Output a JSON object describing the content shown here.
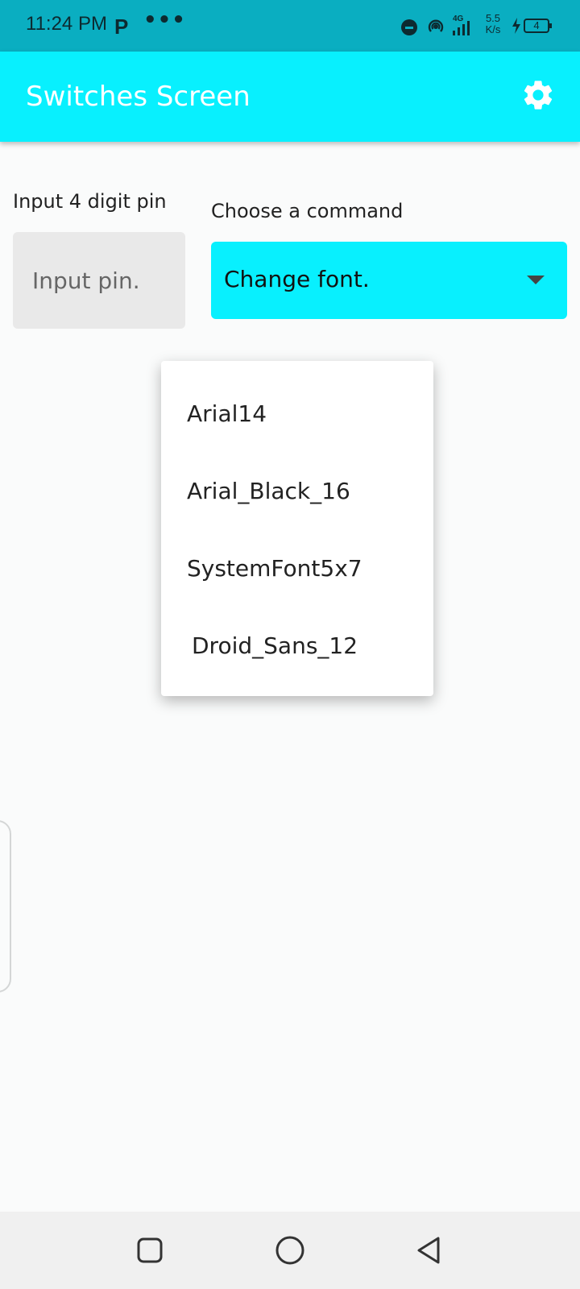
{
  "status_bar": {
    "time": "11:24 PM",
    "p_badge": "P",
    "dots": "•••",
    "speed_value": "5.5",
    "speed_unit": "K/s",
    "network": "4G",
    "battery": "4"
  },
  "app_bar": {
    "title": "Switches Screen",
    "settings_icon": "gear-icon"
  },
  "pin": {
    "label": "Input 4 digit pin",
    "placeholder": "Input pin.",
    "value": ""
  },
  "command": {
    "label": "Choose a command",
    "selected": "Change font."
  },
  "dropdown": {
    "options": [
      "Arial14",
      "Arial_Black_16",
      "SystemFont5x7",
      "Droid_Sans_12"
    ]
  },
  "colors": {
    "status_bar": "#0aaec1",
    "app_bar": "#08f0fe",
    "accent": "#08f0fe",
    "pin_field": "#e9e9e9"
  }
}
